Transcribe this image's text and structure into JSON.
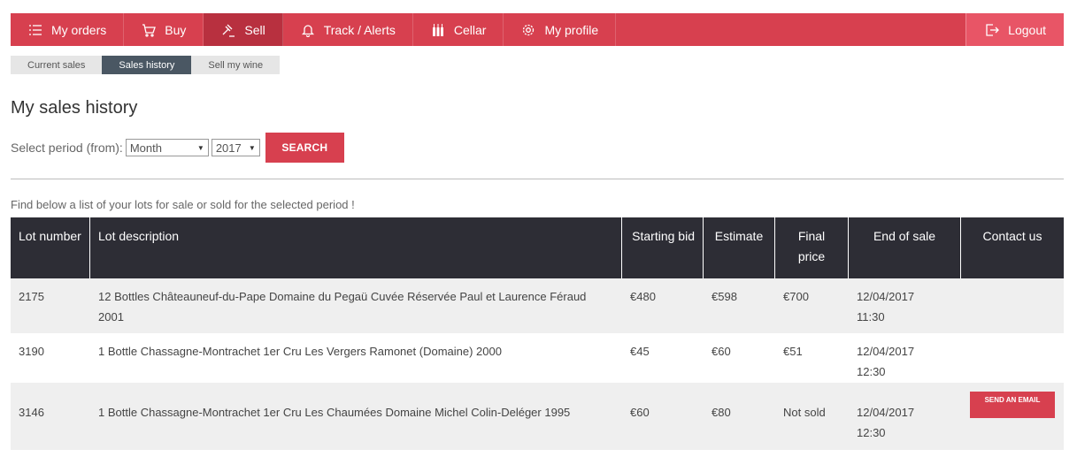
{
  "nav": {
    "items": [
      {
        "label": "My orders",
        "icon": "list-icon"
      },
      {
        "label": "Buy",
        "icon": "cart-icon"
      },
      {
        "label": "Sell",
        "icon": "hammer-icon"
      },
      {
        "label": "Track / Alerts",
        "icon": "bell-icon"
      },
      {
        "label": "Cellar",
        "icon": "bottles-icon"
      },
      {
        "label": "My profile",
        "icon": "gear-icon"
      }
    ],
    "active": "Sell",
    "logout": "Logout"
  },
  "subtabs": [
    {
      "label": "Current sales"
    },
    {
      "label": "Sales history"
    },
    {
      "label": "Sell my wine"
    }
  ],
  "page": {
    "title": "My sales history",
    "period_label": "Select period (from):",
    "month_value": "Month",
    "year_value": "2017",
    "search_button": "SEARCH",
    "intro": "Find below a list of your lots for sale or sold for the selected period !"
  },
  "colors": {
    "accent": "#d7404f",
    "header_bg": "#2d2d35",
    "subtab_active": "#4a5763"
  },
  "table": {
    "headers": {
      "lot_number": "Lot number",
      "lot_description": "Lot description",
      "starting_bid": "Starting bid",
      "estimate": "Estimate",
      "final_price": "Final price",
      "end_of_sale": "End of sale",
      "contact_us": "Contact us"
    },
    "rows": [
      {
        "lot": "2175",
        "desc": "12 Bottles Châteauneuf-du-Pape Domaine du Pegaü Cuvée Réservée Paul et Laurence Féraud 2001",
        "start": "€480",
        "estimate": "€598",
        "final": "€700",
        "end_date": "12/04/2017",
        "end_time": "11:30"
      },
      {
        "lot": "3190",
        "desc": "1 Bottle Chassagne-Montrachet 1er Cru Les Vergers Ramonet (Domaine) 2000",
        "start": "€45",
        "estimate": "€60",
        "final": "€51",
        "end_date": "12/04/2017",
        "end_time": "12:30"
      },
      {
        "lot": "3146",
        "desc": "1 Bottle Chassagne-Montrachet 1er Cru Les Chaumées Domaine Michel Colin-Deléger 1995",
        "start": "€60",
        "estimate": "€80",
        "final": "Not sold",
        "end_date": "12/04/2017",
        "end_time": "12:30",
        "contact": "SEND AN EMAIL"
      }
    ]
  }
}
